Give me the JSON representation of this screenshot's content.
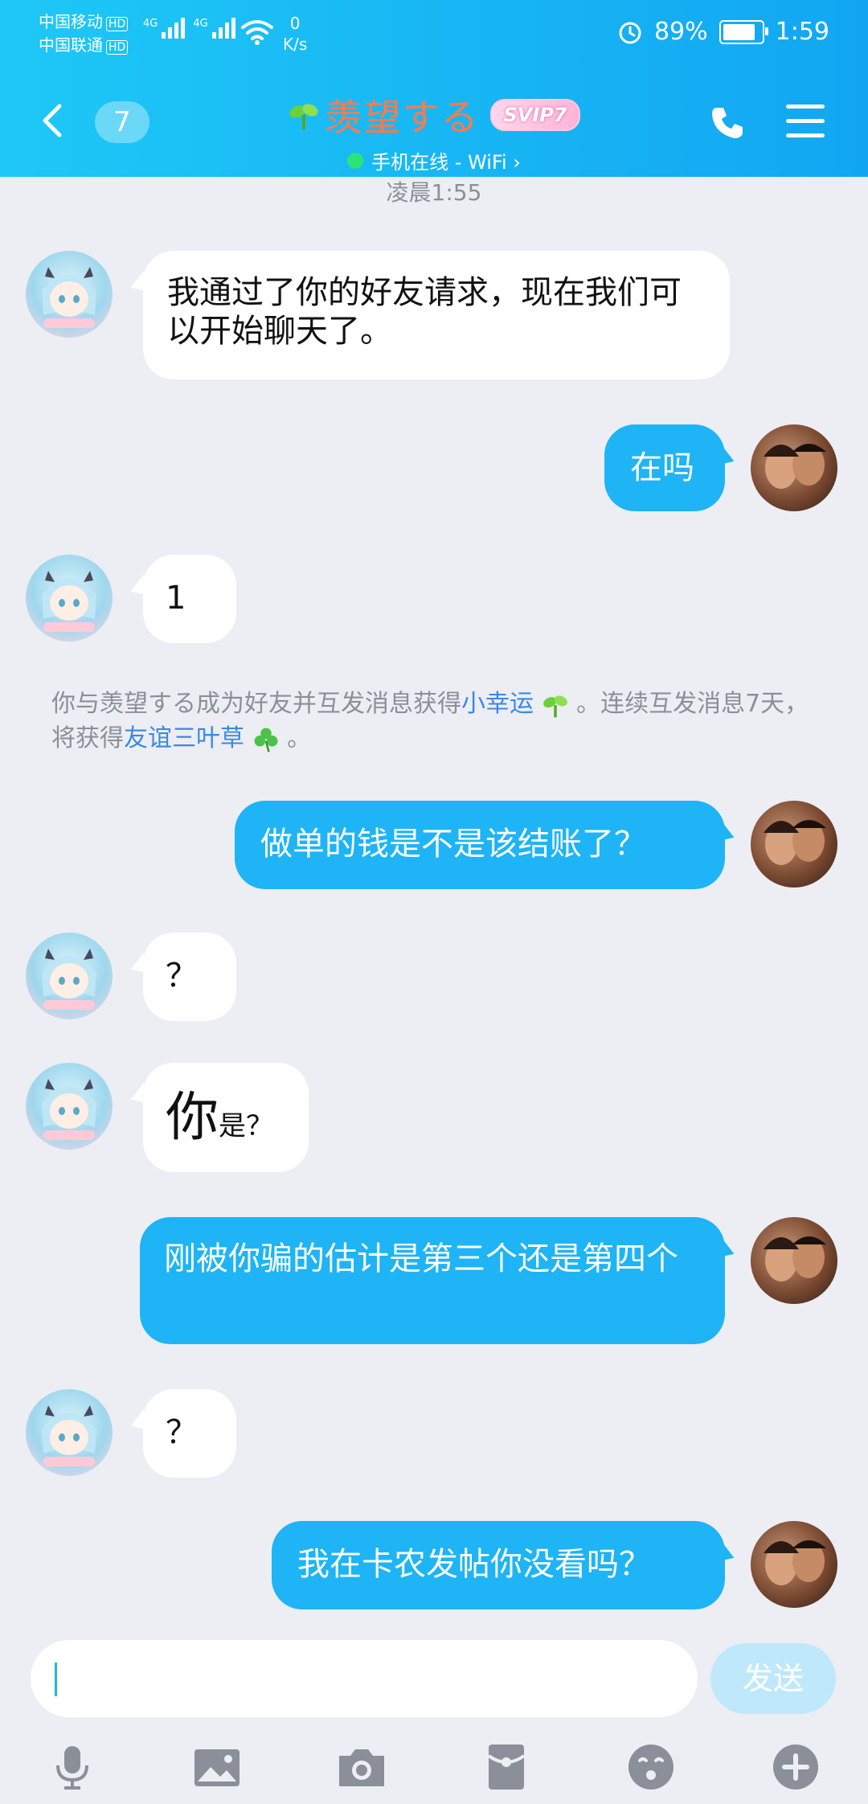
{
  "status_bar": {
    "carrier1": "中国移动",
    "carrier2": "中国联通",
    "hd": "HD",
    "net": "4G",
    "speed_value": "0",
    "speed_unit": "K/s",
    "battery": "89%",
    "battery_level": 0.89,
    "time": "1:59"
  },
  "header": {
    "unread_count": "7",
    "contact_name": "羡望する",
    "vip_badge": "SVIP7",
    "online_status": "手机在线 - WiFi ›"
  },
  "chat": {
    "timestamp": "凌晨1:55",
    "messages": [
      {
        "side": "left",
        "text": "我通过了你的好友请求，现在我们可以开始聊天了。"
      },
      {
        "side": "right",
        "text": "在吗"
      },
      {
        "side": "left",
        "text": "1"
      },
      {
        "side": "right",
        "text": "做单的钱是不是该结账了？"
      },
      {
        "side": "left",
        "text": "？"
      },
      {
        "side": "left",
        "text_big": "你",
        "text_small": "是？"
      },
      {
        "side": "right",
        "text": "刚被你骗的估计是第三个还是第四个"
      },
      {
        "side": "left",
        "text": "？"
      },
      {
        "side": "right",
        "text": "我在卡农发帖你没看吗？"
      }
    ],
    "notice": {
      "part1": "你与羡望する成为好友并互发消息获得",
      "link1": "小幸运",
      "part2": "。连续互发消息7天，将获得",
      "link2": "友谊三叶草",
      "part3": "。"
    }
  },
  "input": {
    "value": "",
    "send_label": "发送"
  },
  "toolbar": {
    "icons": [
      "microphone-icon",
      "image-icon",
      "camera-icon",
      "red-packet-icon",
      "emoji-icon",
      "plus-icon"
    ]
  },
  "colors": {
    "header_start": "#1ec8f6",
    "header_end": "#12a6f2",
    "bubble_self": "#1eb4f5",
    "bubble_other": "#ffffff",
    "background": "#eceef3",
    "name": "#ff7a4a",
    "link": "#3a88e6"
  }
}
